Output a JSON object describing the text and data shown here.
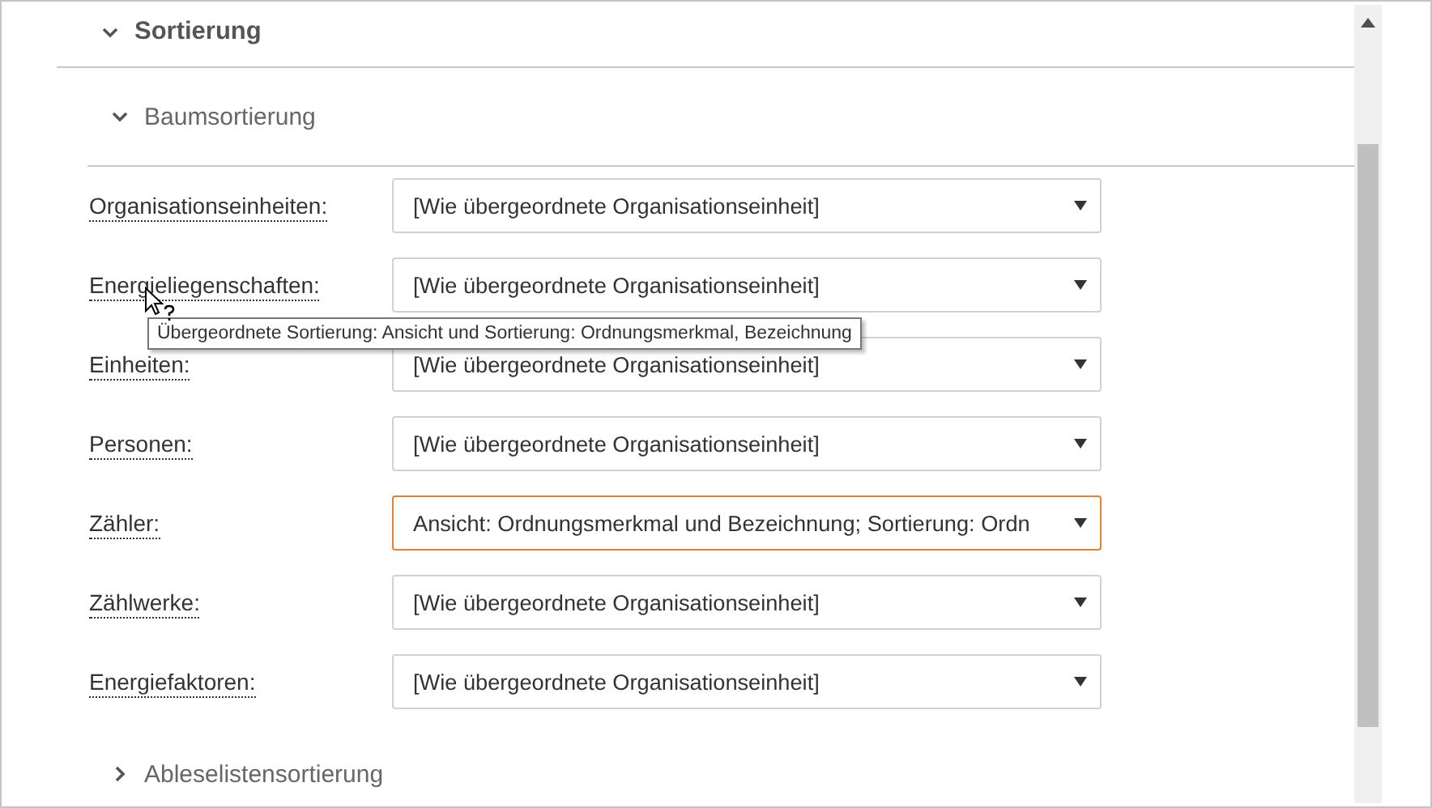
{
  "section": {
    "title": "Sortierung",
    "expanded": true,
    "subsections": [
      {
        "title": "Baumsortierung",
        "expanded": true,
        "fields": [
          {
            "label": "Organisationseinheiten:",
            "value": "[Wie übergeordnete Organisationseinheit]",
            "focused": false
          },
          {
            "label": "Energieliegenschaften:",
            "value": "[Wie übergeordnete Organisationseinheit]",
            "focused": false
          },
          {
            "label": "Einheiten:",
            "value": "[Wie übergeordnete Organisationseinheit]",
            "focused": false
          },
          {
            "label": "Personen:",
            "value": "[Wie übergeordnete Organisationseinheit]",
            "focused": false
          },
          {
            "label": "Zähler:",
            "value": "Ansicht: Ordnungsmerkmal und Bezeichnung; Sortierung: Ordn",
            "focused": true
          },
          {
            "label": "Zählwerke:",
            "value": "[Wie übergeordnete Organisationseinheit]",
            "focused": false
          },
          {
            "label": "Energiefaktoren:",
            "value": "[Wie übergeordnete Organisationseinheit]",
            "focused": false
          }
        ]
      },
      {
        "title": "Ableselistensortierung",
        "expanded": false
      }
    ]
  },
  "tooltip": {
    "text": "Übergeordnete Sortierung: Ansicht und Sortierung: Ordnungsmerkmal, Bezeichnung"
  }
}
